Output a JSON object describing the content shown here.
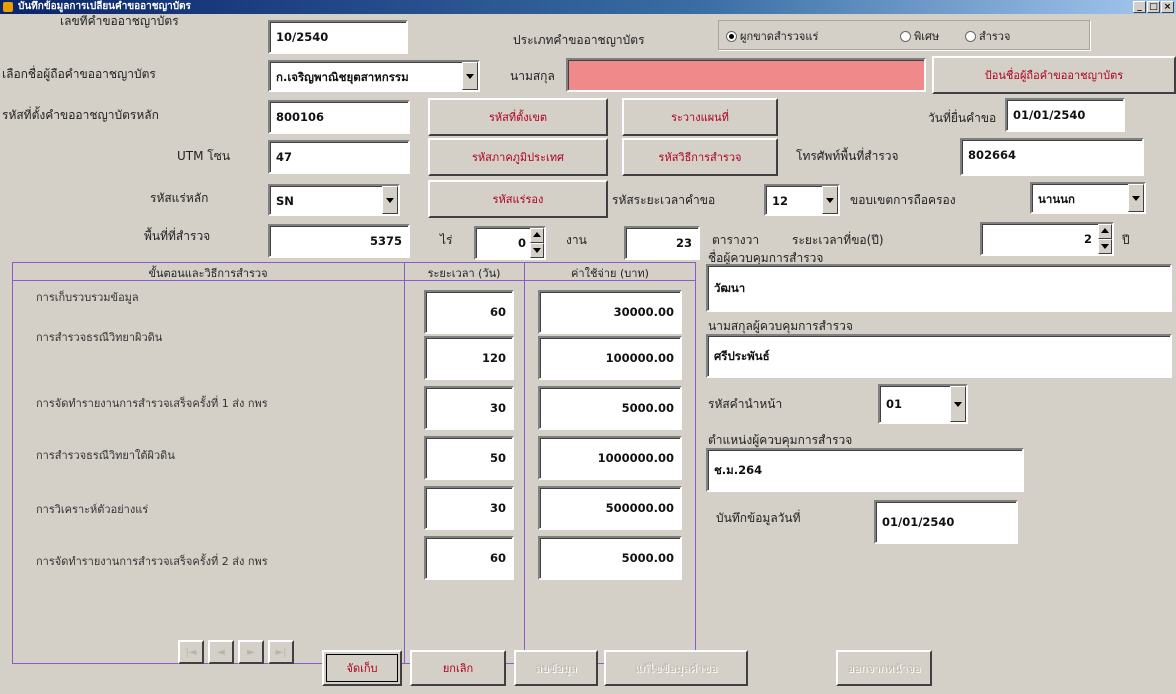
{
  "window": {
    "title": "บันทึกข้อมูลการเปลี่ยนคำขออาชญาบัตร",
    "minimize": "_",
    "maximize": "□",
    "close": "×"
  },
  "header": {
    "permit_no_label": "เลขที่คำขออาชญาบัตร",
    "permit_no_value": "10/2540",
    "permit_type_label": "ประเภทคำขออาชญาบัตร",
    "permit_types": [
      "ผูกขาดสำรวจแร่",
      "พิเศษ",
      "สำรวจ"
    ],
    "permit_type_selected": 0,
    "holder_name_label": "เลือกชื่อผู้ถือคำขออาชญาบัตร",
    "holder_name_value": "ก.เจริญพาณิชยุตสาหกรรม",
    "surname_label": "นามสกุล",
    "surname_value": "",
    "change_holder_button": "ป้อนชื่อผู้ถือคำขออาชญาบัตร",
    "main_code_label": "รหัสที่ตั้งคำขออาชญาบัตรหลัก",
    "main_code_value": "800106",
    "location_code_button": "รหัสที่ตั้งเขต",
    "survey_area_button": "ระวางแผนที่",
    "submit_date_label": "วันที่ยื่นคำขอ",
    "submit_date_value": "01/01/2540",
    "utm_label": "UTM โซน",
    "utm_value": "47",
    "region_code_button": "รหัสภาคภูมิประเทศ",
    "survey_method_button": "รหัสวิธีการสำรวจ",
    "survey_phone_label": "โทรศัพท์พื้นที่สำรวจ",
    "survey_phone_value": "802664",
    "mineral_code_label": "รหัสแร่หลัก",
    "mineral_code_value": "SN",
    "mineral_button": "รหัสแร่รอง",
    "period_label": "รหัสระยะเวลาคำขอ",
    "period_value": "12",
    "unit_label": "ขอบเขตการถือครอง",
    "unit_value": "นานนก",
    "area_label": "พื้นที่ที่สำรวจ",
    "area_value": "5375",
    "rai_label": "ไร่",
    "rai_value": "0",
    "ngan_label": "งาน",
    "ngan_value": "23",
    "wa_label": "ตารางวา",
    "duration_label": "ระยะเวลาที่ขอ(ปี)",
    "duration_value": "2",
    "year_label": "ปี"
  },
  "plan_table": {
    "col_step": "ขั้นตอนและวิธีการสำรวจ",
    "col_days": "ระยะเวลา (วัน)",
    "col_cost": "ค่าใช้จ่าย (บาท)",
    "rows": [
      {
        "step": "การเก็บรวบรวมข้อมูล",
        "days": "60",
        "cost": "30000.00"
      },
      {
        "step": "การสำรวจธรณีวิทยาผิวดิน",
        "days": "120",
        "cost": "100000.00"
      },
      {
        "step": "การจัดทำรายงานการสำรวจเสร็จครั้งที่ 1 ส่ง กพร",
        "days": "30",
        "cost": "5000.00"
      },
      {
        "step": "การสำรวจธรณีวิทยาใต้ผิวดิน",
        "days": "50",
        "cost": "1000000.00"
      },
      {
        "step": "การวิเคราะห์ตัวอย่างแร่",
        "days": "30",
        "cost": "500000.00"
      },
      {
        "step": "การจัดทำรายงานการสำรวจเสร็จครั้งที่ 2 ส่ง กพร",
        "days": "60",
        "cost": "5000.00"
      }
    ]
  },
  "supervisor": {
    "name_label": "ชื่อผู้ควบคุมการสำรวจ",
    "name_value": "วัฒนา",
    "surname_label": "นามสกุลผู้ควบคุมการสำรวจ",
    "surname_value": "ศรีประพันธ์",
    "prefix_label": "รหัสคำนำหน้า",
    "prefix_value": "01",
    "position_label": "ตำแหน่งผู้ควบคุมการสำรวจ",
    "position_value": "ช.ม.264",
    "record_date_label": "บันทึกข้อมูลวันที่",
    "record_date_value": "01/01/2540"
  },
  "footer": {
    "nav": [
      "|◄",
      "◄",
      "►",
      "►|"
    ],
    "save_button": "จัดเก็บ",
    "cancel_button": "ยกเลิก",
    "btn3": "ลบข้อมูล",
    "btn4": "แก้ไขข้อมูลคำขอ",
    "btn5": "ออกจากหน้าจอ"
  }
}
